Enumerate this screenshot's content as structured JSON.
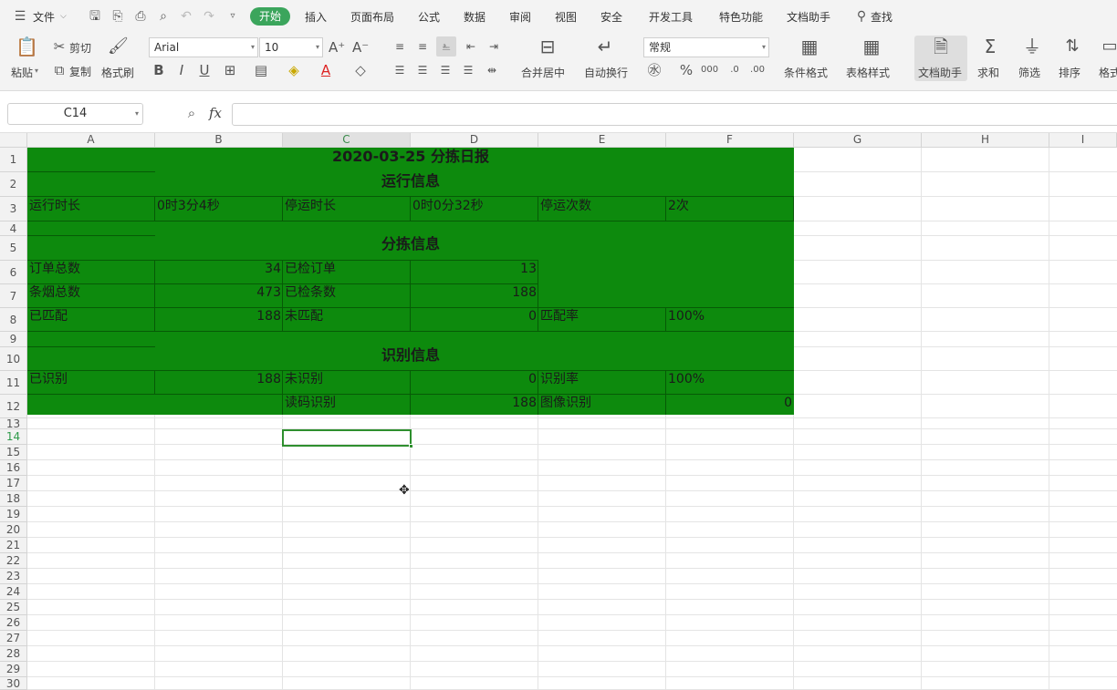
{
  "menu": {
    "file": "文件",
    "tabs": [
      "开始",
      "插入",
      "页面布局",
      "公式",
      "数据",
      "审阅",
      "视图",
      "安全",
      "开发工具",
      "特色功能",
      "文档助手"
    ],
    "search": "查找"
  },
  "ribbon": {
    "paste": "粘贴",
    "cut": "剪切",
    "copy": "复制",
    "format_painter": "格式刷",
    "font_name": "Arial",
    "font_size": "10",
    "merge_center": "合并居中",
    "wrap_text": "自动换行",
    "number_format": "常规",
    "conditional_format": "条件格式",
    "table_style": "表格样式",
    "doc_assistant": "文档助手",
    "sum": "求和",
    "filter": "筛选",
    "sort": "排序",
    "format": "格式"
  },
  "formula_bar": {
    "name_box": "C14",
    "fx": "fx",
    "value": ""
  },
  "columns": [
    "A",
    "B",
    "C",
    "D",
    "E",
    "F",
    "G",
    "H",
    "I"
  ],
  "rows": [
    "1",
    "2",
    "3",
    "4",
    "5",
    "6",
    "7",
    "8",
    "9",
    "10",
    "11",
    "12",
    "13",
    "14",
    "15",
    "16",
    "17",
    "18",
    "19",
    "20",
    "21",
    "22",
    "23",
    "24",
    "25",
    "26",
    "27",
    "28",
    "29",
    "30"
  ],
  "sheet": {
    "title": "2020-03-25 分拣日报",
    "section_run": "运行信息",
    "run_time_label": "运行时长",
    "run_time_value": "0时3分4秒",
    "stop_time_label": "停运时长",
    "stop_time_value": "0时0分32秒",
    "stop_count_label": "停运次数",
    "stop_count_value": "2次",
    "section_sort": "分拣信息",
    "order_total_label": "订单总数",
    "order_total_value": "34",
    "checked_order_label": "已检订单",
    "checked_order_value": "13",
    "cig_total_label": "条烟总数",
    "cig_total_value": "473",
    "checked_cig_label": "已检条数",
    "checked_cig_value": "188",
    "matched_label": "已匹配",
    "matched_value": "188",
    "unmatched_label": "未匹配",
    "unmatched_value": "0",
    "match_rate_label": "匹配率",
    "match_rate_value": "100%",
    "section_recog": "识别信息",
    "recognized_label": "已识别",
    "recognized_value": "188",
    "unrecognized_label": "未识别",
    "unrecognized_value": "0",
    "recog_rate_label": "识别率",
    "recog_rate_value": "100%",
    "barcode_label": "读码识别",
    "barcode_value": "188",
    "image_label": "图像识别",
    "image_value": "0"
  },
  "colors": {
    "green_fill": "#0d8a0d",
    "active_tab": "#3ba55c"
  }
}
